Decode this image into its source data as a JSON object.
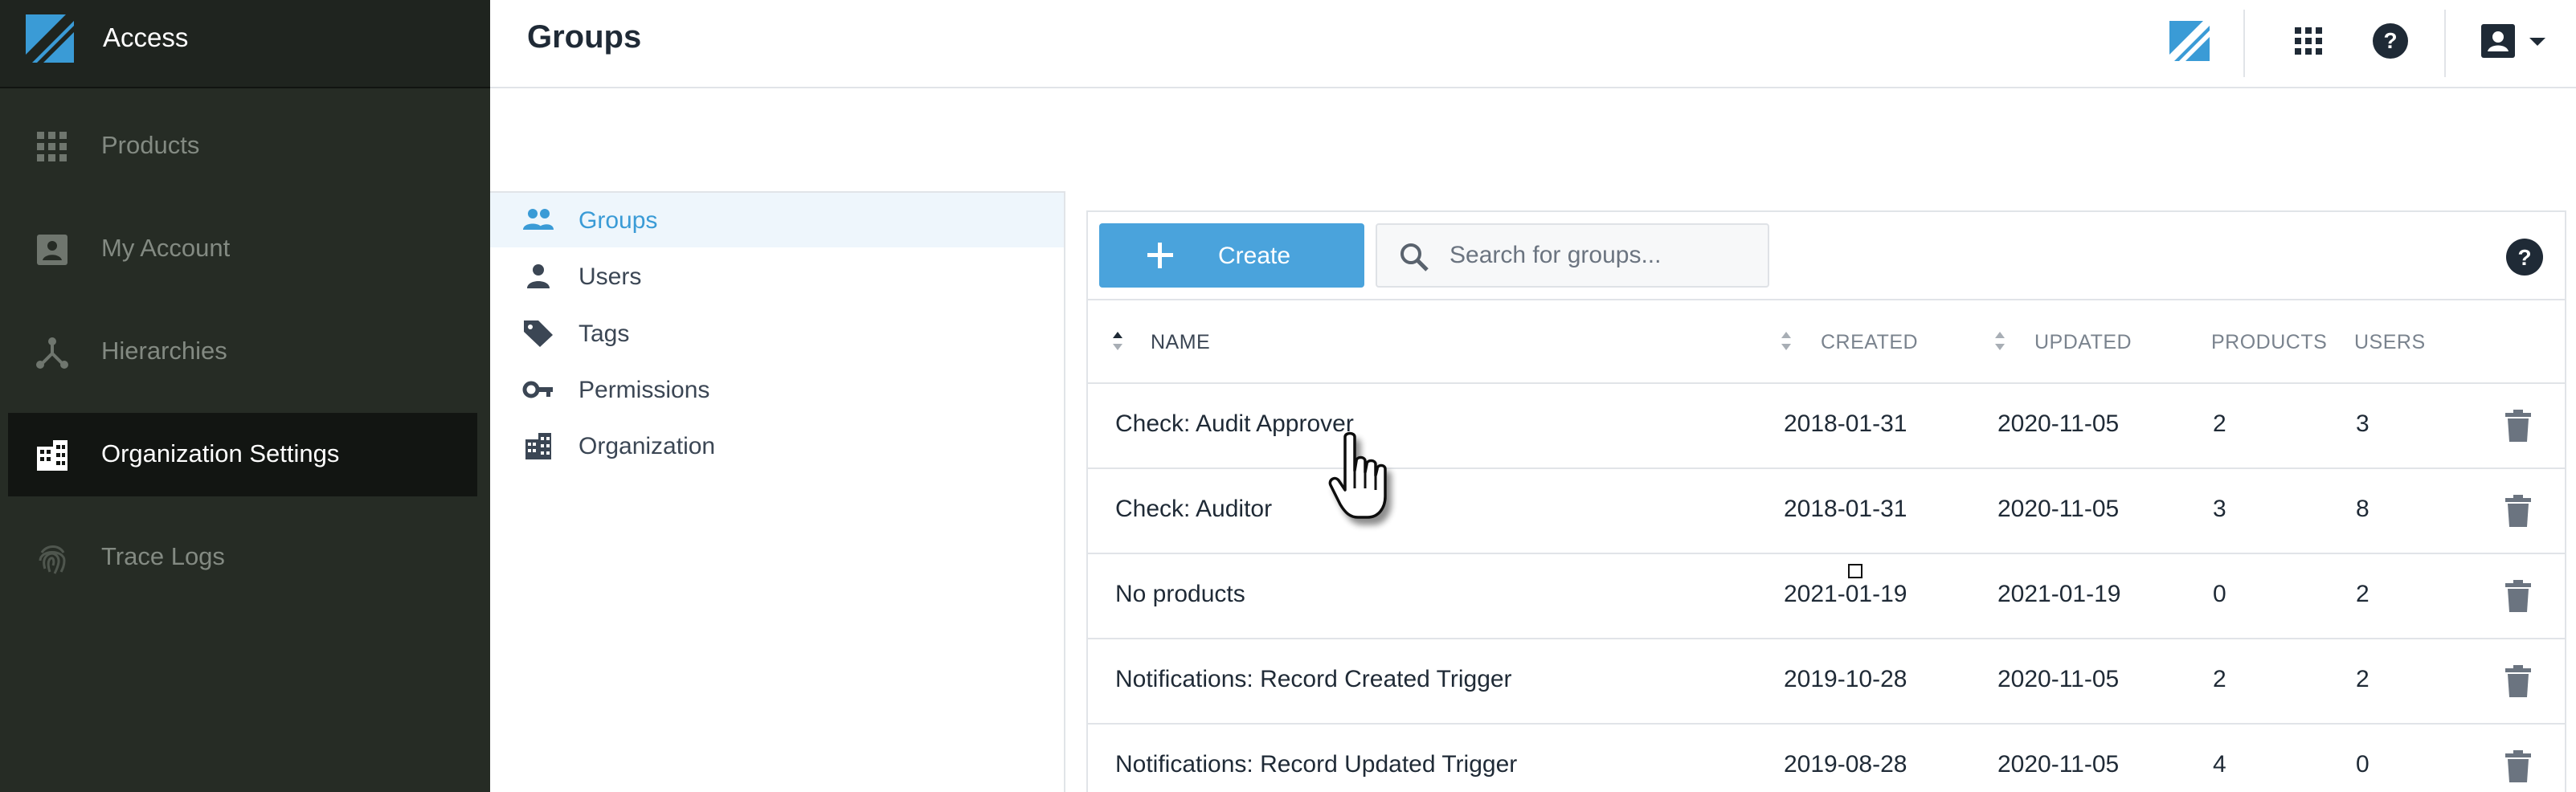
{
  "app": {
    "brand_label": "Access"
  },
  "sidebar": {
    "items": [
      {
        "label": "Products",
        "icon": "grid-icon"
      },
      {
        "label": "My Account",
        "icon": "account-box-icon"
      },
      {
        "label": "Hierarchies",
        "icon": "hierarchy-icon"
      },
      {
        "label": "Organization Settings",
        "icon": "building-icon",
        "active": true
      },
      {
        "label": "Trace Logs",
        "icon": "fingerprint-icon"
      }
    ]
  },
  "header": {
    "title": "Groups",
    "icons": [
      "brand-logo-icon",
      "apps-grid-icon",
      "help-icon",
      "account-menu-icon",
      "caret-down-icon"
    ]
  },
  "subnav": {
    "items": [
      {
        "label": "Groups",
        "icon": "people-icon",
        "active": true
      },
      {
        "label": "Users",
        "icon": "person-icon"
      },
      {
        "label": "Tags",
        "icon": "tag-icon"
      },
      {
        "label": "Permissions",
        "icon": "key-icon"
      },
      {
        "label": "Organization",
        "icon": "building-icon"
      }
    ]
  },
  "toolbar": {
    "create_label": "Create",
    "search_placeholder": "Search for groups...",
    "search_value": ""
  },
  "table": {
    "columns": {
      "name": "NAME",
      "created": "CREATED",
      "updated": "UPDATED",
      "products": "PRODUCTS",
      "users": "USERS"
    },
    "rows": [
      {
        "name": "Check: Audit Approver",
        "created": "2018-01-31",
        "updated": "2020-11-05",
        "products": "2",
        "users": "3"
      },
      {
        "name": "Check: Auditor",
        "created": "2018-01-31",
        "updated": "2020-11-05",
        "products": "3",
        "users": "8"
      },
      {
        "name": "No products",
        "created": "2021-01-19",
        "updated": "2021-01-19",
        "products": "0",
        "users": "2"
      },
      {
        "name": "Notifications: Record Created Trigger",
        "created": "2019-10-28",
        "updated": "2020-11-05",
        "products": "2",
        "users": "2"
      },
      {
        "name": "Notifications: Record Updated Trigger",
        "created": "2019-08-28",
        "updated": "2020-11-05",
        "products": "4",
        "users": "0"
      }
    ]
  },
  "colors": {
    "sidebar_bg": "#262c25",
    "sidebar_active_bg": "#121512",
    "accent": "#4aa3dc",
    "subnav_active_bg": "#eef6fc"
  }
}
